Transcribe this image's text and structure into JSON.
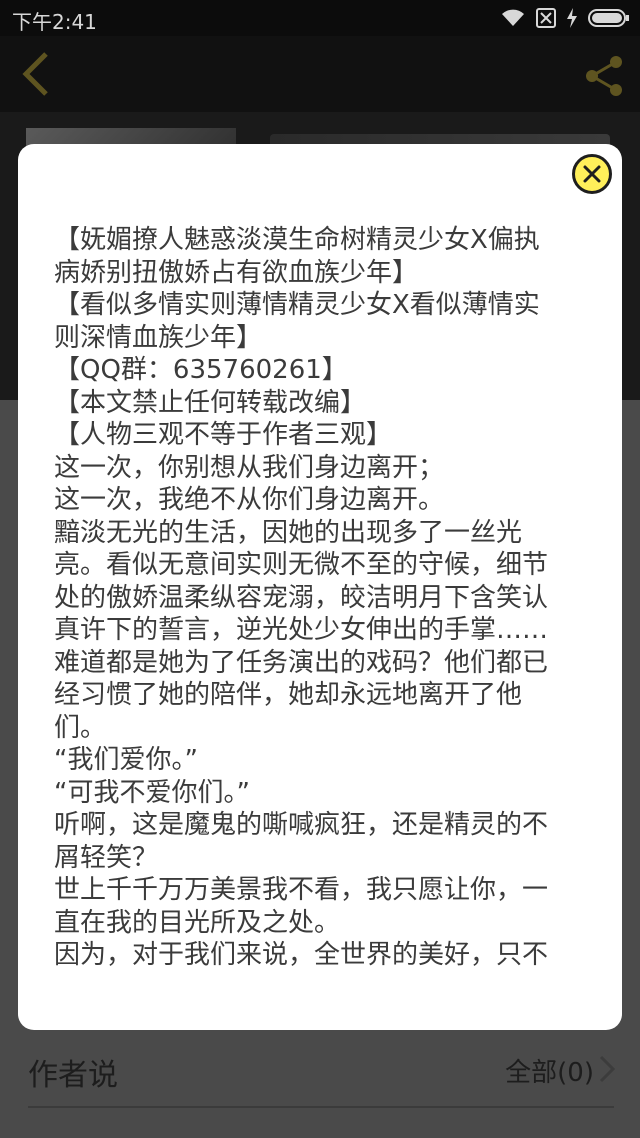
{
  "status_bar": {
    "time": "下午2:41"
  },
  "icons": {
    "wifi": "wifi-icon",
    "sim": "no-sim-icon",
    "charging": "charging-icon",
    "battery": "battery-icon",
    "back": "chevron-left-icon",
    "share": "share-icon",
    "close": "close-icon",
    "chevron": "chevron-right-icon"
  },
  "colors": {
    "accent": "#d3c03a",
    "close_bg": "#ffef5a",
    "overlay_bg": "#4a4a4a",
    "text": "#3b3b3b"
  },
  "description_lines": [
    "【妩媚撩人魅惑淡漠生命树精灵少女X偏执",
    "病娇别扭傲娇占有欲血族少年】",
    "【看似多情实则薄情精灵少女X看似薄情实",
    "则深情血族少年】",
    "【QQ群：635760261】",
    "【本文禁止任何转载改编】",
    "【人物三观不等于作者三观】",
    "这一次，你别想从我们身边离开；",
    "这一次，我绝不从你们身边离开。",
    "黯淡无光的生活，因她的出现多了一丝光",
    "亮。看似无意间实则无微不至的守候，细节",
    "处的傲娇温柔纵容宠溺，皎洁明月下含笑认",
    "真许下的誓言，逆光处少女伸出的手掌……",
    "难道都是她为了任务演出的戏码？他们都已",
    "经习惯了她的陪伴，她却永远地离开了他",
    "们。",
    "“我们爱你。”",
    "“可我不爱你们。”",
    "听啊，这是魔鬼的嘶喊疯狂，还是精灵的不",
    "屑轻笑？",
    "世上千千万万美景我不看，我只愿让你，一",
    "直在我的目光所及之处。",
    "因为，对于我们来说，全世界的美好，只不"
  ],
  "author_section": {
    "label": "作者说",
    "all_label": "全部(0)"
  }
}
